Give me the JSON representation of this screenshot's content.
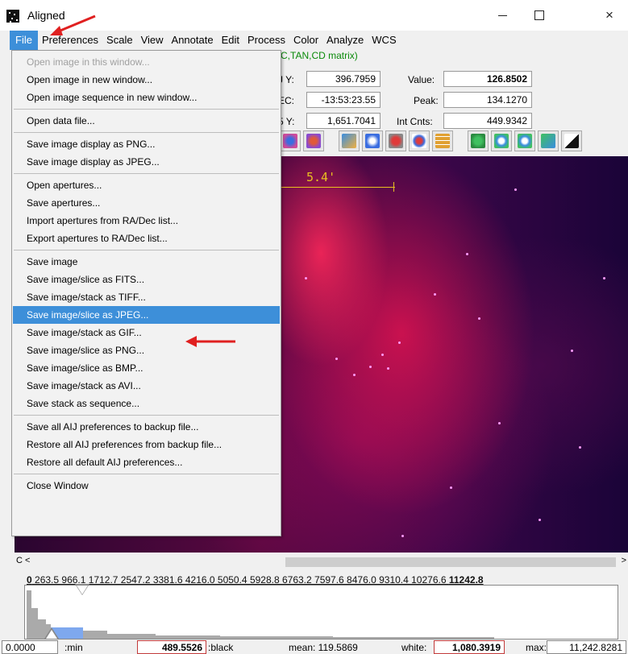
{
  "window": {
    "title": "Aligned",
    "minimize": "",
    "maximize": "",
    "close": "×"
  },
  "menubar": [
    "File",
    "Preferences",
    "Scale",
    "View",
    "Annotate",
    "Edit",
    "Process",
    "Color",
    "Analyze",
    "WCS"
  ],
  "info": {
    "wcs_line": "EC,TAN,CD matrix)",
    "y_label": "J Y:",
    "y_value": "396.7959",
    "dec_label": "EC:",
    "dec_value": "-13:53:23.55",
    "sy_label": "5 Y:",
    "sy_value": "1,651.7041",
    "value_label": "Value:",
    "value_value": "126.8502",
    "peak_label": "Peak:",
    "peak_value": "134.1270",
    "intcnts_label": "Int Cnts:",
    "intcnts_value": "449.9342"
  },
  "image": {
    "scale_label": "5.4'"
  },
  "file_menu": [
    {
      "label": "Open image in this window...",
      "disabled": true
    },
    {
      "label": "Open image in new window..."
    },
    {
      "label": "Open image sequence in new window..."
    },
    {
      "sep": true
    },
    {
      "label": "Open data file..."
    },
    {
      "sep": true
    },
    {
      "label": "Save image display as PNG..."
    },
    {
      "label": "Save image display as JPEG..."
    },
    {
      "sep": true
    },
    {
      "label": "Open apertures..."
    },
    {
      "label": "Save apertures..."
    },
    {
      "label": "Import apertures from RA/Dec list..."
    },
    {
      "label": "Export apertures to RA/Dec list..."
    },
    {
      "sep": true
    },
    {
      "label": "Save image"
    },
    {
      "label": "Save image/slice as FITS..."
    },
    {
      "label": "Save image/stack as TIFF..."
    },
    {
      "label": "Save image/slice as JPEG...",
      "selected": true
    },
    {
      "label": "Save image/stack as GIF..."
    },
    {
      "label": "Save image/slice as PNG..."
    },
    {
      "label": "Save image/slice as BMP..."
    },
    {
      "label": "Save image/stack as AVI..."
    },
    {
      "label": "Save stack as sequence..."
    },
    {
      "sep": true
    },
    {
      "label": "Save all AIJ preferences to backup file..."
    },
    {
      "label": "Restore all AIJ preferences from backup file..."
    },
    {
      "label": "Restore all default AIJ preferences..."
    },
    {
      "sep": true
    },
    {
      "label": "Close Window"
    }
  ],
  "scroll": {
    "left_text": "C <",
    "right_arrow": ">"
  },
  "histogram": {
    "ticks_prefix": "0",
    "ticks": "263.5  966.1  1712.7  2547.2  3381.6  4216.0  5050.4  5928.8  6763.2  7597.6  8476.0  9310.4  10276.6",
    "ticks_max": "11242.8"
  },
  "stats": {
    "min_value": "0.0000",
    "min_label": ":min",
    "black_value": "489.5526",
    "black_label": ":black",
    "mean": "mean: 119.5869",
    "white_label": "white:",
    "white_value": "1,080.3919",
    "max_label": "max:",
    "max_value": "11,242.8281"
  },
  "colors": {
    "menu_highlight": "#3d8fd9",
    "annotation_arrow": "#e02020",
    "scale_bar": "#e8c020"
  }
}
